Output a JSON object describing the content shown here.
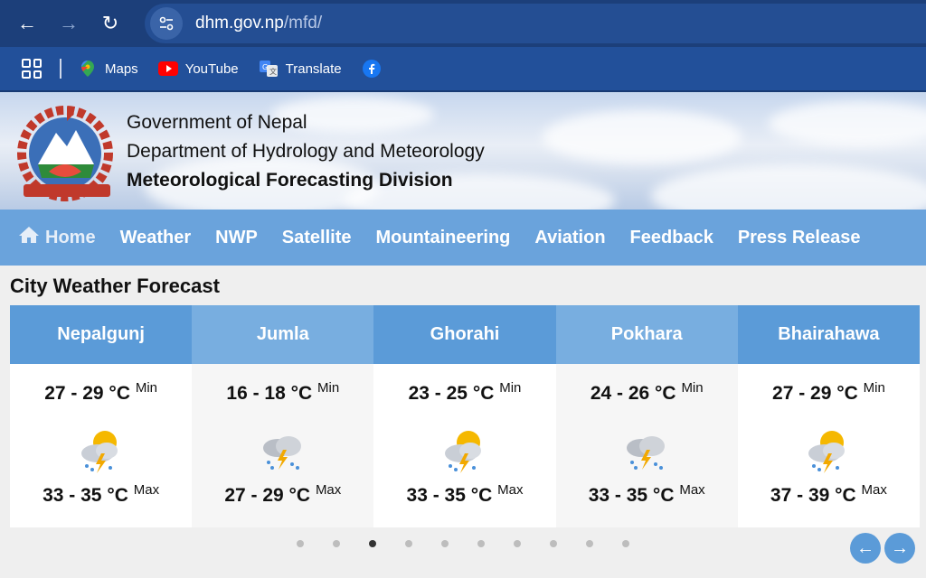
{
  "browser": {
    "url_domain": "dhm.gov.np",
    "url_path": "/mfd/",
    "bookmarks": [
      {
        "label": "Maps",
        "icon": "maps-icon"
      },
      {
        "label": "YouTube",
        "icon": "youtube-icon"
      },
      {
        "label": "Translate",
        "icon": "translate-icon"
      },
      {
        "label": "",
        "icon": "facebook-icon"
      }
    ]
  },
  "header": {
    "line1": "Government of Nepal",
    "line2": "Department of Hydrology and Meteorology",
    "line3": "Meteorological Forecasting Division"
  },
  "nav": {
    "items": [
      "Home",
      "Weather",
      "NWP",
      "Satellite",
      "Mountaineering",
      "Aviation",
      "Feedback",
      "Press Release"
    ]
  },
  "forecast": {
    "title": "City Weather Forecast",
    "min_label": "Min",
    "max_label": "Max",
    "cities": [
      {
        "name": "Nepalgunj",
        "min": "27 - 29 °C",
        "max": "33 - 35 °C",
        "icon": "sun-thunderstorm-icon"
      },
      {
        "name": "Jumla",
        "min": "16 - 18 °C",
        "max": "27 - 29 °C",
        "icon": "thunderstorm-rain-icon"
      },
      {
        "name": "Ghorahi",
        "min": "23 - 25 °C",
        "max": "33 - 35 °C",
        "icon": "sun-thunderstorm-icon"
      },
      {
        "name": "Pokhara",
        "min": "24 - 26 °C",
        "max": "33 - 35 °C",
        "icon": "thunderstorm-rain-icon"
      },
      {
        "name": "Bhairahawa",
        "min": "27 - 29 °C",
        "max": "37 - 39 °C",
        "icon": "sun-thunderstorm-icon"
      }
    ],
    "active_page": 3,
    "page_count": 10
  },
  "colors": {
    "chrome": "#1c3f7a",
    "nav": "#6aa3dc",
    "card_head": "#5b9bd8"
  }
}
